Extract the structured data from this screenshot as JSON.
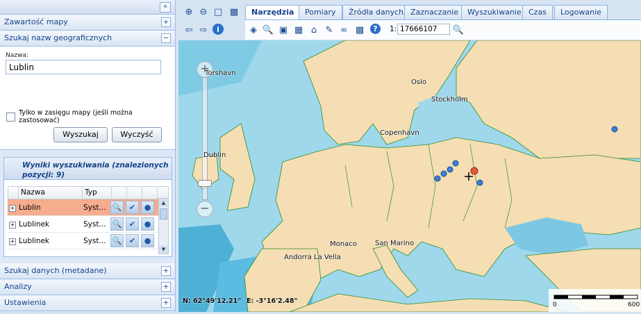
{
  "left_panel": {
    "collapse_glyph": "«",
    "sections": {
      "map_content": "Zawartość mapy",
      "geo_search": "Szukaj nazw geograficznych",
      "data_search": "Szukaj danych (metadane)",
      "analysis": "Analizy",
      "settings": "Ustawienia"
    },
    "toggle_expanded": "−",
    "toggle_collapsed": "+",
    "search": {
      "name_label": "Nazwa:",
      "name_value": "Lublin",
      "extent_label": "Tylko w zasięgu mapy (jeśli można zastosować)",
      "search_button": "Wyszukaj",
      "clear_button": "Wyczyść"
    },
    "results": {
      "title": "Wyniki wyszukiwania (znalezionych pozycji: 9)",
      "columns": [
        "Nazwa",
        "Typ"
      ],
      "rows": [
        {
          "name": "Lublin",
          "type": "Syst...",
          "selected": true
        },
        {
          "name": "Lublinek",
          "type": "Syst...",
          "selected": false
        },
        {
          "name": "Lublinek",
          "type": "Syst...",
          "selected": false
        }
      ]
    }
  },
  "tabs": [
    "Narzędzia",
    "Pomiary",
    "Źródła danych",
    "Zaznaczanie",
    "Wyszukiwanie",
    "Czas",
    "Logowanie"
  ],
  "active_tab": "Narzędzia",
  "scale": {
    "prefix": "1:",
    "value": "17666107"
  },
  "map": {
    "places": [
      "Torshavn",
      "Stockholm",
      "Oslo",
      "Copenhavn",
      "Dublin",
      "Monaco",
      "San Marino",
      "Andorra La Vella"
    ],
    "coords": {
      "lat": "N: 62°49'12.21\"",
      "lon": "E: -3°16'2.48\""
    },
    "scale_bar": {
      "start": "0",
      "end": "600"
    },
    "colors": {
      "sea": "#9fd8ea",
      "land": "#f5deb3",
      "border": "#2e8b2e",
      "highlight": "#f5ad8e"
    }
  }
}
